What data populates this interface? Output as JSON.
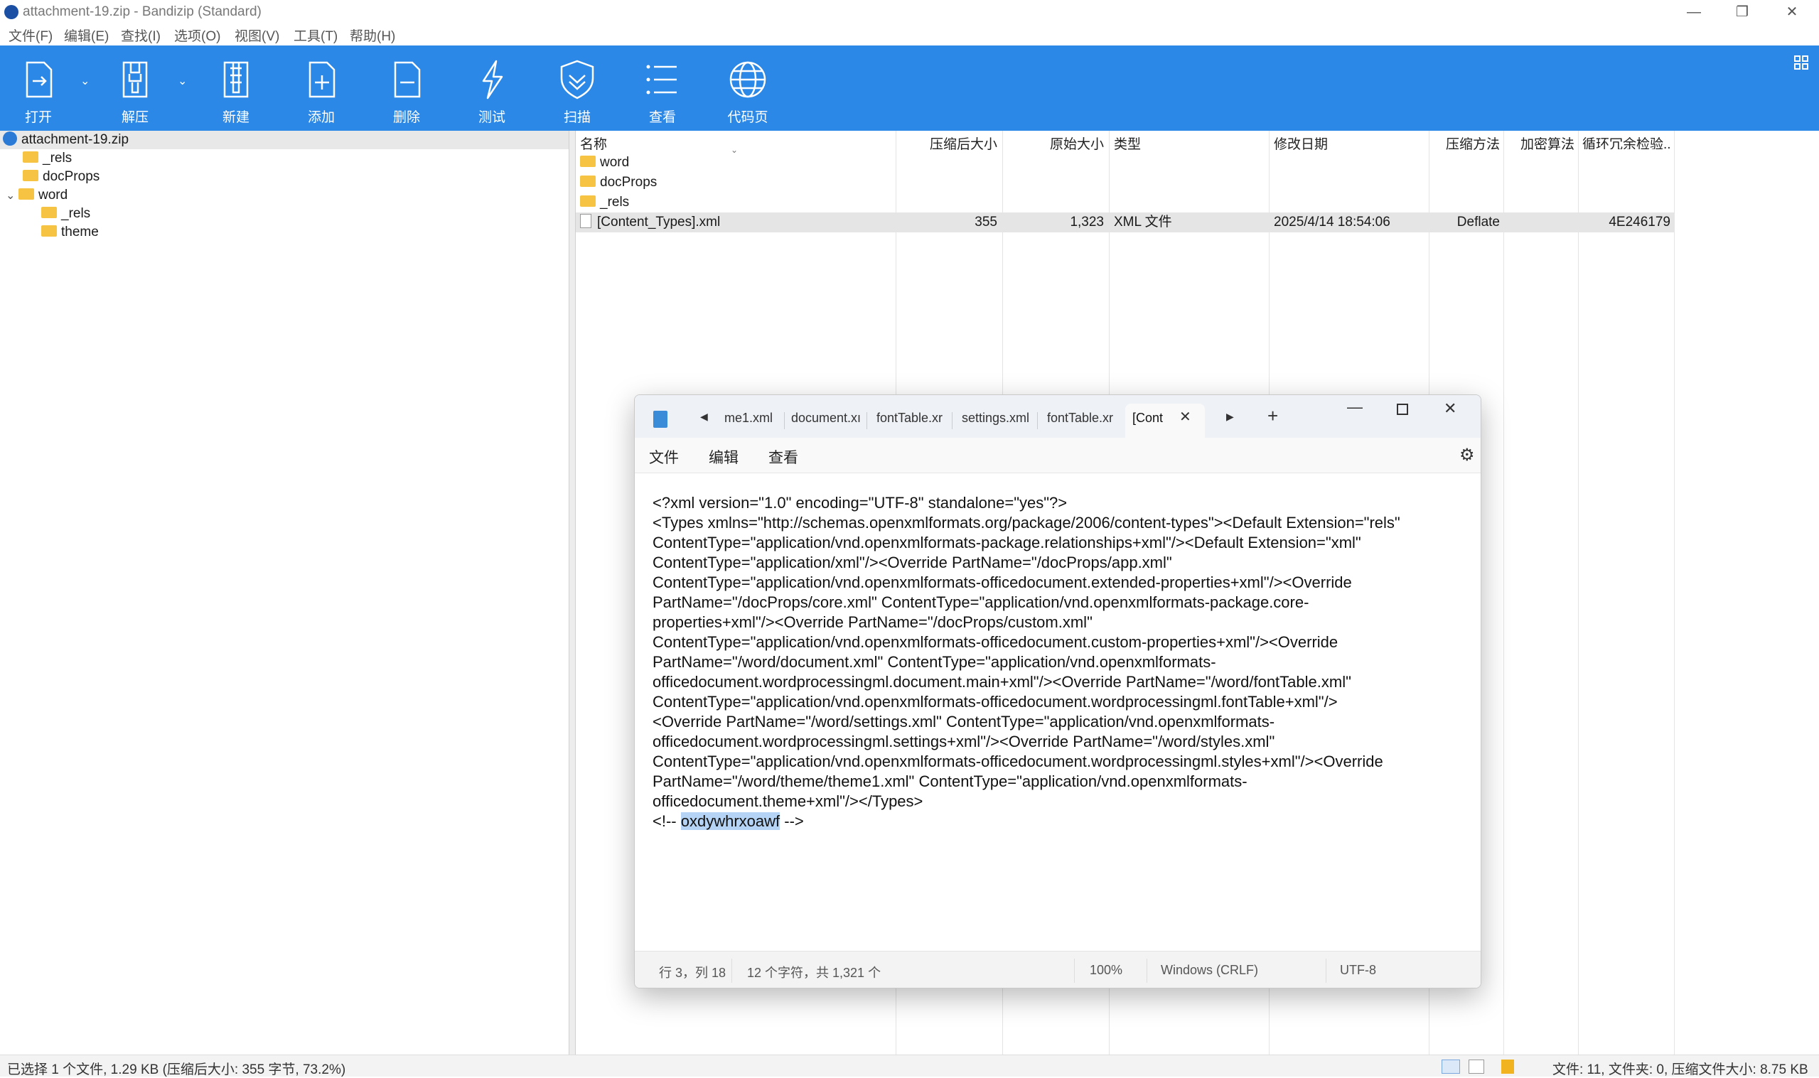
{
  "window": {
    "title": "attachment-19.zip - Bandizip (Standard)"
  },
  "menubar": [
    "文件(F)",
    "编辑(E)",
    "查找(I)",
    "选项(O)",
    "视图(V)",
    "工具(T)",
    "帮助(H)"
  ],
  "toolbar": {
    "buttons": [
      {
        "label": "打开",
        "icon": "open-icon"
      },
      {
        "label": "解压",
        "icon": "extract-icon"
      },
      {
        "label": "新建",
        "icon": "new-archive-icon"
      },
      {
        "label": "添加",
        "icon": "add-icon"
      },
      {
        "label": "删除",
        "icon": "delete-icon"
      },
      {
        "label": "测试",
        "icon": "test-icon"
      },
      {
        "label": "扫描",
        "icon": "scan-shield-icon"
      },
      {
        "label": "查看",
        "icon": "view-list-icon"
      },
      {
        "label": "代码页",
        "icon": "codepage-globe-icon"
      }
    ]
  },
  "tree": {
    "root": "attachment-19.zip",
    "items": [
      {
        "label": "_rels",
        "level": 1
      },
      {
        "label": "docProps",
        "level": 1
      },
      {
        "label": "word",
        "level": 1,
        "expanded": true
      },
      {
        "label": "_rels",
        "level": 2
      },
      {
        "label": "theme",
        "level": 2
      }
    ]
  },
  "list": {
    "columns": [
      "名称",
      "压缩后大小",
      "原始大小",
      "类型",
      "修改日期",
      "压缩方法",
      "加密算法",
      "循环冗余检验..."
    ],
    "rows": [
      {
        "name": "word",
        "kind": "folder"
      },
      {
        "name": "docProps",
        "kind": "folder"
      },
      {
        "name": "_rels",
        "kind": "folder"
      },
      {
        "name": "[Content_Types].xml",
        "kind": "file",
        "packed": "355",
        "size": "1,323",
        "type": "XML 文件",
        "modified": "2025/4/14 18:54:06",
        "method": "Deflate",
        "crc": "4E246179",
        "selected": true
      }
    ]
  },
  "statusbar": {
    "left": "已选择 1 个文件, 1.29 KB (压缩后大小: 355 字节, 73.2%)",
    "right": "文件: 11, 文件夹: 0, 压缩文件大小: 8.75 KB"
  },
  "notepad": {
    "tabs": [
      "me1.xml",
      "document.xı",
      "fontTable.xr",
      "settings.xml",
      "fontTable.xr",
      "[Cont"
    ],
    "menu": [
      "文件",
      "编辑",
      "查看"
    ],
    "text_lines": [
      "<?xml version=\"1.0\" encoding=\"UTF-8\" standalone=\"yes\"?>",
      "<Types xmlns=\"http://schemas.openxmlformats.org/package/2006/content-types\"><Default Extension=\"rels\"",
      "ContentType=\"application/vnd.openxmlformats-package.relationships+xml\"/><Default Extension=\"xml\"",
      "ContentType=\"application/xml\"/><Override PartName=\"/docProps/app.xml\"",
      "ContentType=\"application/vnd.openxmlformats-officedocument.extended-properties+xml\"/><Override",
      "PartName=\"/docProps/core.xml\" ContentType=\"application/vnd.openxmlformats-package.core-",
      "properties+xml\"/><Override PartName=\"/docProps/custom.xml\"",
      "ContentType=\"application/vnd.openxmlformats-officedocument.custom-properties+xml\"/><Override",
      "PartName=\"/word/document.xml\" ContentType=\"application/vnd.openxmlformats-",
      "officedocument.wordprocessingml.document.main+xml\"/><Override PartName=\"/word/fontTable.xml\"",
      "ContentType=\"application/vnd.openxmlformats-officedocument.wordprocessingml.fontTable+xml\"/>",
      "<Override PartName=\"/word/settings.xml\" ContentType=\"application/vnd.openxmlformats-",
      "officedocument.wordprocessingml.settings+xml\"/><Override PartName=\"/word/styles.xml\"",
      "ContentType=\"application/vnd.openxmlformats-officedocument.wordprocessingml.styles+xml\"/><Override",
      "PartName=\"/word/theme/theme1.xml\" ContentType=\"application/vnd.openxmlformats-",
      "officedocument.theme+xml\"/></Types>"
    ],
    "comment_prefix": "<!-- ",
    "comment_selected": "oxdywhrxoawf",
    "comment_suffix": " -->",
    "status": {
      "position": "行 3，列 18",
      "chars": "12 个字符，共 1,321 个",
      "zoom": "100%",
      "line_ending": "Windows (CRLF)",
      "encoding": "UTF-8"
    }
  },
  "colors": {
    "toolbar": "#2b88e6",
    "selection": "#b4d3f5",
    "folder": "#f6c343"
  }
}
